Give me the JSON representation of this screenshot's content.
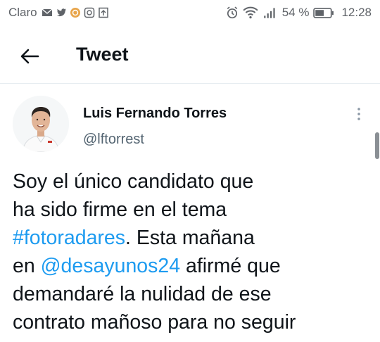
{
  "status_bar": {
    "carrier": "Claro",
    "battery_percent": "54 %",
    "time": "12:28",
    "icons": [
      "mail-icon",
      "twitter-icon",
      "notification-icon",
      "whatsapp-icon",
      "upload-icon",
      "alarm-icon",
      "wifi-icon",
      "signal-icon",
      "battery-icon"
    ]
  },
  "header": {
    "back_icon": "back-arrow-icon",
    "title": "Tweet"
  },
  "tweet": {
    "author": {
      "name": "Luis Fernando Torres",
      "handle": "@lftorrest"
    },
    "text": {
      "line1": "Soy el único candidato que",
      "line2": "ha sido firme en el tema",
      "line3_link": "#fotoradares",
      "line3_rest": ". Esta mañana",
      "line4_pre": "en ",
      "line4_link": "@desayunos24",
      "line4_rest": " afirmé que",
      "line5": "demandaré la nulidad de ese",
      "line6": "contrato mañoso para no seguir"
    }
  },
  "colors": {
    "link": "#1d9bf0",
    "text": "#0f1419",
    "secondary": "#536471"
  }
}
